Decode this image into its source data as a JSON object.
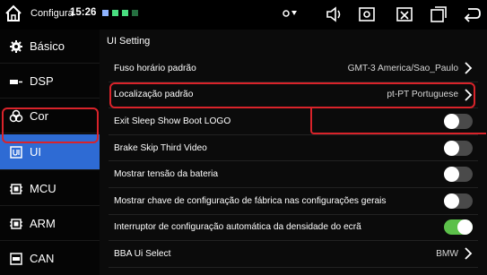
{
  "statusbar": {
    "app_title": "Configura",
    "time": "15:26"
  },
  "sidebar": {
    "items": [
      {
        "label": "Básico",
        "icon": "gear-icon"
      },
      {
        "label": "DSP",
        "icon": "dsp-icon"
      },
      {
        "label": "Cor",
        "icon": "color-palette-icon"
      },
      {
        "label": "UI",
        "icon": "ui-icon"
      },
      {
        "label": "MCU",
        "icon": "chip-icon"
      },
      {
        "label": "ARM",
        "icon": "chip-icon"
      },
      {
        "label": "CAN",
        "icon": "can-icon"
      }
    ],
    "active_index": 3
  },
  "main": {
    "section_title": "UI Setting",
    "rows": [
      {
        "label": "Fuso horário padrão",
        "value": "GMT-3 America/Sao_Paulo",
        "kind": "nav"
      },
      {
        "label": "Localização padrão",
        "value": "pt-PT Portuguese",
        "kind": "nav"
      },
      {
        "label": "Exit Sleep Show Boot LOGO",
        "kind": "toggle",
        "on": false
      },
      {
        "label": "Brake Skip Third Video",
        "kind": "toggle",
        "on": false
      },
      {
        "label": "Mostrar tensão da bateria",
        "kind": "toggle",
        "on": false
      },
      {
        "label": "Mostrar chave de configuração de fábrica nas configurações gerais",
        "kind": "toggle",
        "on": false
      },
      {
        "label": "Interruptor de configuração automática da densidade do ecrã",
        "kind": "toggle",
        "on": true
      },
      {
        "label": "BBA Ui Select",
        "value": "BMW",
        "kind": "nav"
      }
    ]
  },
  "colors": {
    "active_blue": "#2e6bd4",
    "highlight_red": "#d9232a",
    "toggle_on_green": "#5cc04a"
  }
}
